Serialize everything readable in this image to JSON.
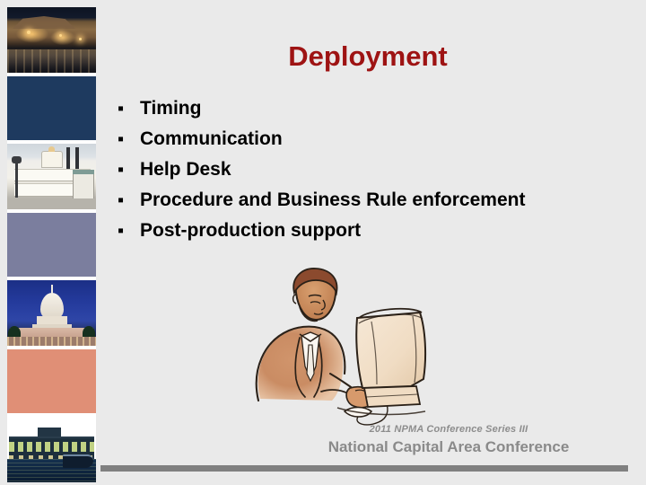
{
  "slide": {
    "title": "Deployment",
    "background_color": "#eaeaea",
    "title_color": "#9e1313"
  },
  "bullets": {
    "marker": "▪",
    "items": [
      {
        "text": "Timing"
      },
      {
        "text": "Communication"
      },
      {
        "text": "Help Desk"
      },
      {
        "text": "Procedure and Business Rule enforcement"
      },
      {
        "text": "Post-production support"
      }
    ]
  },
  "sidebar": {
    "tiles": [
      {
        "name": "night-street-photo",
        "type": "photo",
        "description": "Historic street at night with lit storefronts and wet pavement reflections"
      },
      {
        "name": "navy-block",
        "type": "solid",
        "color": "#1e3a5f"
      },
      {
        "name": "riverboat-pavilion-photo",
        "type": "photo",
        "description": "White waterfront pavilion / riverboat in daylight"
      },
      {
        "name": "periwinkle-block",
        "type": "solid",
        "color": "#7b7e9e"
      },
      {
        "name": "us-capitol-photo",
        "type": "photo",
        "description": "United States Capitol dome illuminated at dusk"
      },
      {
        "name": "salmon-block",
        "type": "solid",
        "color": "#e08f76"
      },
      {
        "name": "waterfront-night-photo",
        "type": "photo",
        "description": "Waterfront buildings and boats lit at night"
      }
    ]
  },
  "illustration": {
    "name": "businessman-at-computer-illustration",
    "description": "Sketch-style illustration of a businessman in a suit working at a computer monitor"
  },
  "footer": {
    "series": "2011 NPMA Conference Series III",
    "conference": "National Capital Area Conference",
    "bar_color": "#808080"
  }
}
